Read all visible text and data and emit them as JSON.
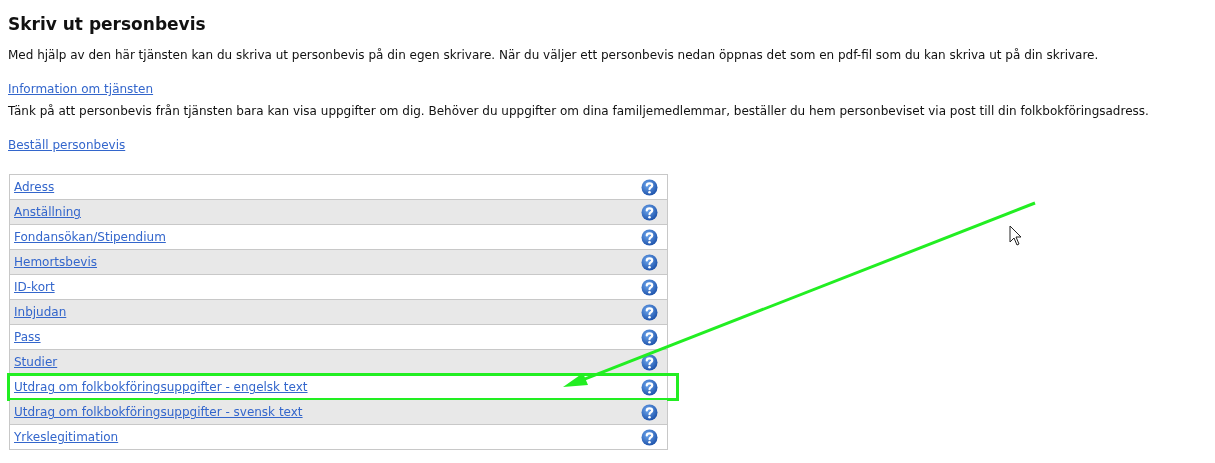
{
  "title": "Skriv ut personbevis",
  "intro": "Med hjälp av den här tjänsten kan du skriva ut personbevis på din egen skrivare. När du väljer ett personbevis nedan öppnas det som en pdf-fil som du kan skriva ut på din skrivare.",
  "info_link": "Information om tjänsten",
  "note": "Tänk på att personbevis från tjänsten bara kan visa uppgifter om dig. Behöver du uppgifter om dina familjemedlemmar, beställer du hem personbeviset via post till din folkbokföringsadress.",
  "order_link": "Beställ personbevis",
  "items": [
    {
      "label": "Adress",
      "annotated": false
    },
    {
      "label": "Anställning",
      "annotated": false
    },
    {
      "label": "Fondansökan/Stipendium",
      "annotated": false
    },
    {
      "label": "Hemortsbevis",
      "annotated": false
    },
    {
      "label": "ID-kort",
      "annotated": false
    },
    {
      "label": "Inbjudan",
      "annotated": false
    },
    {
      "label": "Pass",
      "annotated": false
    },
    {
      "label": "Studier",
      "annotated": false
    },
    {
      "label": "Utdrag om folkbokföringsuppgifter - engelsk text",
      "annotated": true
    },
    {
      "label": "Utdrag om folkbokföringsuppgifter - svensk text",
      "annotated": false
    },
    {
      "label": "Yrkeslegitimation",
      "annotated": false
    }
  ]
}
